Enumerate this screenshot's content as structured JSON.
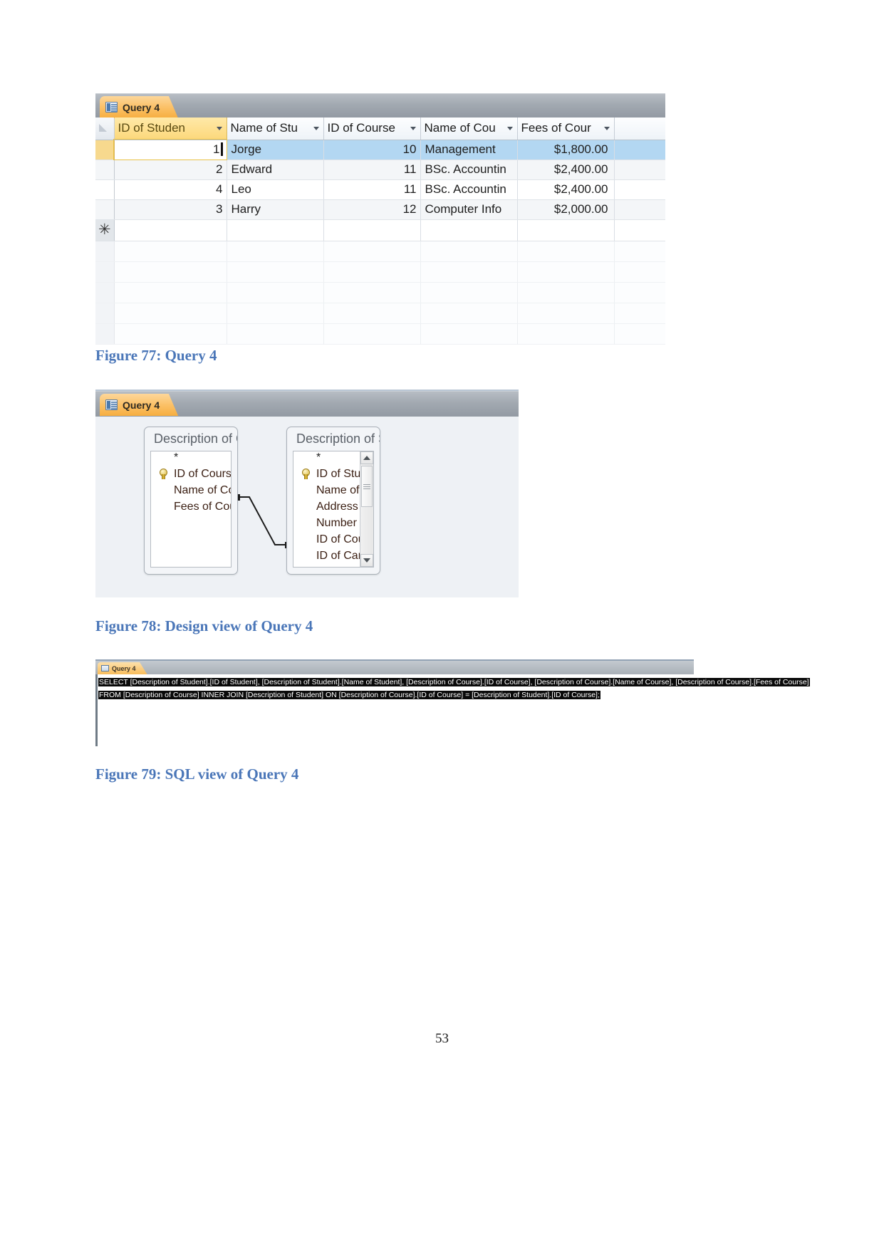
{
  "page": {
    "number": "53"
  },
  "figure77": {
    "tab_label": "Query 4",
    "columns": [
      {
        "label": "ID of Studen",
        "active": true
      },
      {
        "label": "Name of Stu",
        "active": false
      },
      {
        "label": "ID of Course",
        "active": false
      },
      {
        "label": "Name of Cou",
        "active": false
      },
      {
        "label": "Fees of Cour",
        "active": false
      }
    ],
    "rows": [
      {
        "id_student": "1",
        "name_student": "Jorge",
        "id_course": "10",
        "name_course": "Management",
        "fees": "$1,800.00",
        "selected": true
      },
      {
        "id_student": "2",
        "name_student": "Edward",
        "id_course": "11",
        "name_course": "BSc. Accountin",
        "fees": "$2,400.00",
        "selected": false
      },
      {
        "id_student": "4",
        "name_student": "Leo",
        "id_course": "11",
        "name_course": "BSc. Accountin",
        "fees": "$2,400.00",
        "selected": false
      },
      {
        "id_student": "3",
        "name_student": "Harry",
        "id_course": "12",
        "name_course": "Computer Info",
        "fees": "$2,000.00",
        "selected": false
      }
    ],
    "new_record_marker": "✳",
    "caption": "Figure 77: Query 4"
  },
  "figure78": {
    "tab_label": "Query 4",
    "tables": [
      {
        "title": "Description of C...",
        "star": "*",
        "fields": [
          {
            "name": "ID of Course",
            "key": true
          },
          {
            "name": "Name of Course",
            "key": false
          },
          {
            "name": "Fees of Course",
            "key": false
          }
        ]
      },
      {
        "title": "Description of St...",
        "star": "*",
        "fields": [
          {
            "name": "ID of Student",
            "key": true
          },
          {
            "name": "Name of Studer",
            "key": false
          },
          {
            "name": "Address of Stuc",
            "key": false
          },
          {
            "name": "Number of Stuc",
            "key": false
          },
          {
            "name": "ID of Course",
            "key": false
          },
          {
            "name": "ID of Campus",
            "key": false
          }
        ],
        "has_scrollbar": true
      }
    ],
    "caption": "Figure 78: Design view of Query 4"
  },
  "figure79": {
    "tab_label": "Query 4",
    "sql_line1": "SELECT [Description of Student].[ID of Student], [Description of Student].[Name of Student], [Description of Course].[ID of Course], [Description of Course].[Name of Course], [Description of Course].[Fees of Course]",
    "sql_line2": "FROM [Description of Course] INNER JOIN [Description of Student] ON [Description of Course].[ID of Course] = [Description of Student].[ID of Course];",
    "caption": "Figure 79: SQL view of Query 4"
  },
  "colors": {
    "caption_blue": "#4a76b8",
    "tab_orange": "#f8bd5c",
    "row_selected": "#b3d7f2",
    "header_active": "#fcd87b"
  }
}
